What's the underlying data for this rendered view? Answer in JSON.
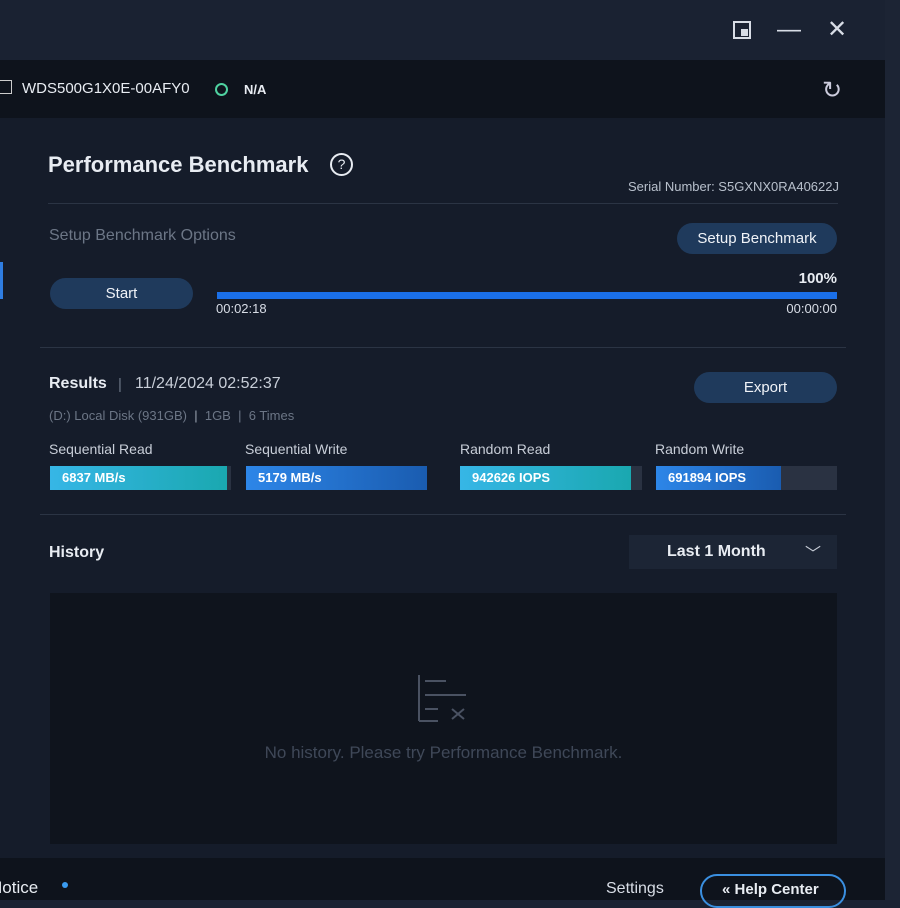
{
  "window": {
    "restore_icon": "window-snap-icon",
    "minimize_icon": "minimize-icon",
    "close_icon": "close-icon"
  },
  "device": {
    "name": "WDS500G1X0E-00AFY0",
    "status": "N/A",
    "status_color": "#4fd1a0"
  },
  "page": {
    "title": "Performance Benchmark",
    "serial": "Serial Number: S5GXNX0RA40622J"
  },
  "setup": {
    "label": "Setup Benchmark Options",
    "button": "Setup Benchmark",
    "start": "Start",
    "progress_percent": 100,
    "progress_label": "100%",
    "elapsed": "00:02:18",
    "remaining": "00:00:00"
  },
  "results": {
    "title": "Results",
    "sep": "|",
    "datetime": "11/24/2024 02:52:37",
    "disk": "(D:) Local Disk (931GB)",
    "size": "1GB",
    "times": "6 Times",
    "export": "Export",
    "metrics": [
      {
        "label": "Sequential Read",
        "value": "6837 MB/s",
        "fill": 0.98
      },
      {
        "label": "Sequential Write",
        "value": "5179 MB/s",
        "fill": 1.0
      },
      {
        "label": "Random Read",
        "value": "942626 IOPS",
        "fill": 0.94
      },
      {
        "label": "Random Write",
        "value": "691894 IOPS",
        "fill": 0.69
      }
    ]
  },
  "history": {
    "title": "History",
    "range": "Last 1 Month",
    "empty": "No history. Please try Performance Benchmark."
  },
  "footer": {
    "notice": "Notice",
    "settings": "Settings",
    "help": "Help Center"
  }
}
